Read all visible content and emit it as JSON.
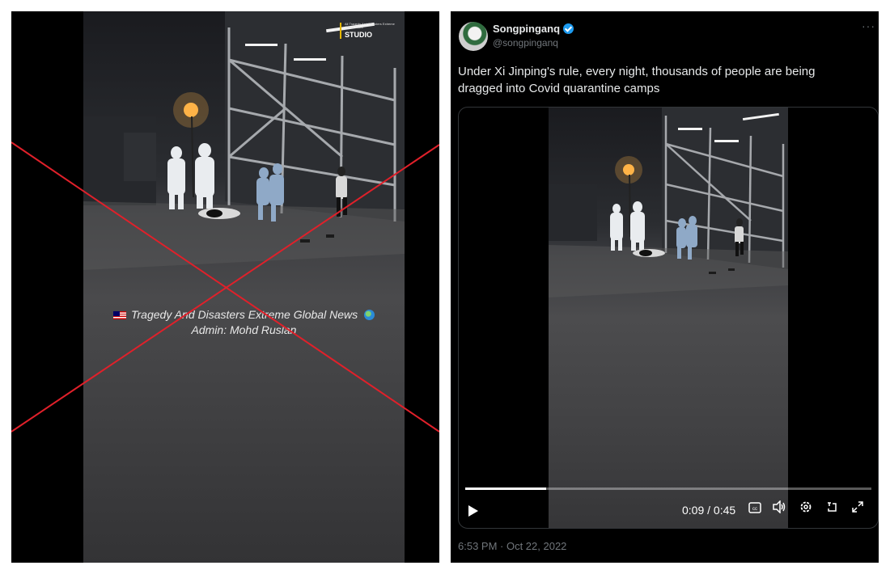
{
  "left": {
    "badge_small": "All Tragedy And Disasters Extreme Global News",
    "badge_label": "STUDIO",
    "watermark_line1": "Tragedy And Disasters Extreme Global News",
    "watermark_line2": "Admin: Mohd Ruslan",
    "flag_icon": "malaysia-flag-icon",
    "globe_icon": "globe-icon",
    "cross_color": "#e0202a"
  },
  "tweet": {
    "display_name": "Songpinganq",
    "handle": "@songpinganq",
    "verified": true,
    "more_label": "···",
    "text": "Under Xi Jinping's rule, every night, thousands of people are being dragged into Covid quarantine camps",
    "timestamp": "6:53 PM · Oct 22, 2022"
  },
  "video": {
    "time": "0:09 / 0:45",
    "progress": 0.2,
    "icons": [
      "play-icon",
      "captions-icon",
      "volume-icon",
      "settings-icon",
      "dock-icon",
      "fullscreen-icon"
    ],
    "accent": "#1d9bf0"
  }
}
